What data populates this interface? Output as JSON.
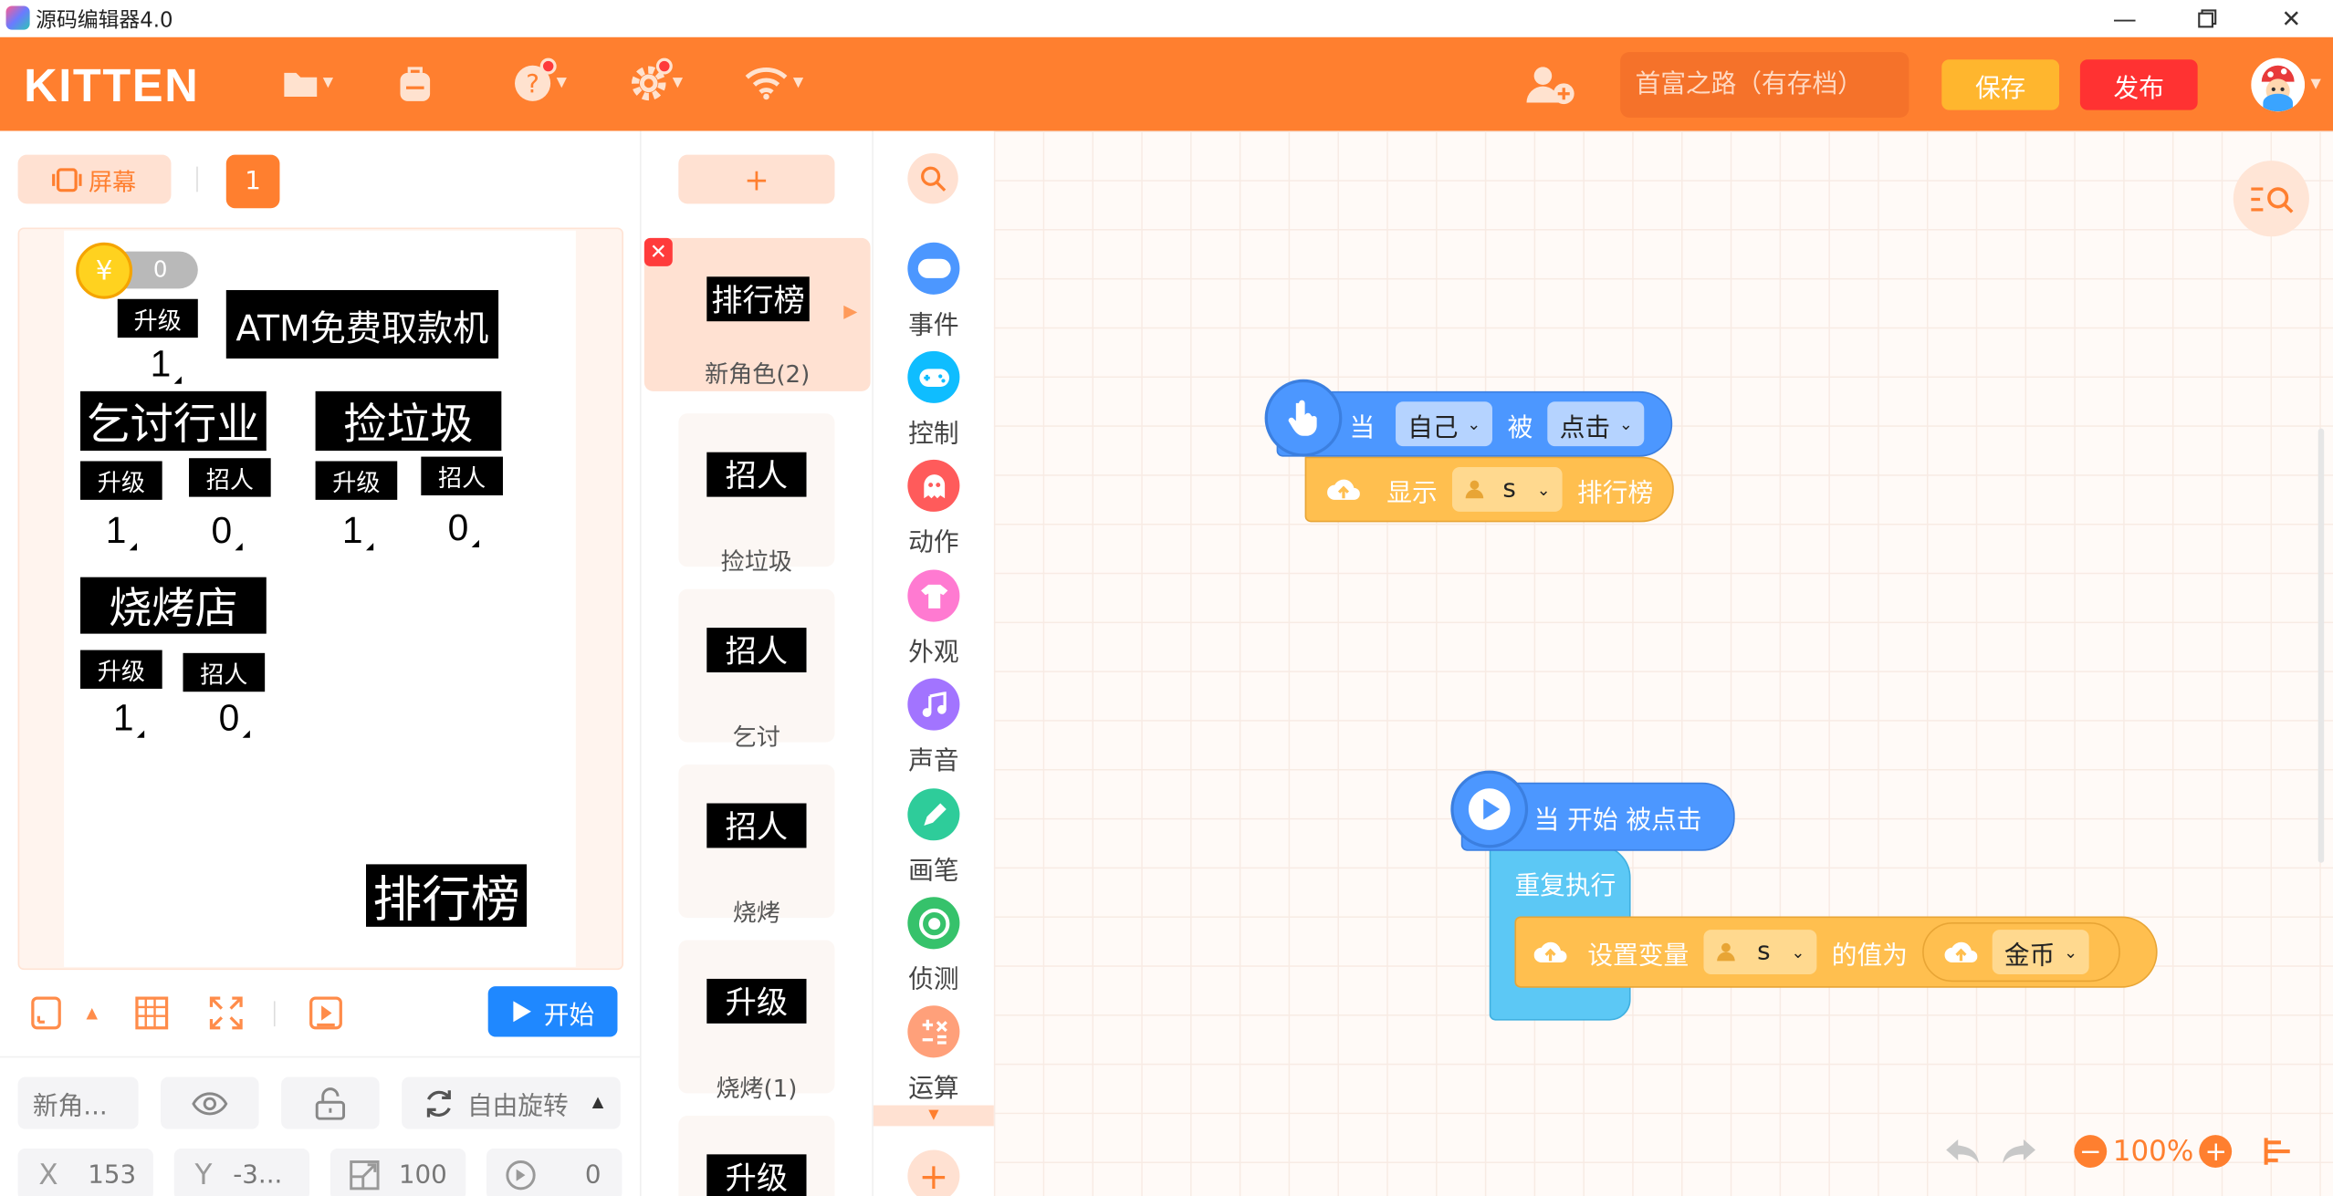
{
  "window": {
    "title": "源码编辑器4.0"
  },
  "header": {
    "logo": "KITTEN",
    "project_placeholder": "首富之路（有存档）",
    "save_label": "保存",
    "publish_label": "发布"
  },
  "left": {
    "screen_label": "屏幕",
    "scene_number": "1",
    "start_label": "开始",
    "sprite_name": "新角...",
    "rotate_label": "自由旋转",
    "x_label": "X",
    "x_value": "153",
    "y_label": "Y",
    "y_value": "-3...",
    "size_value": "100",
    "direction_value": "0"
  },
  "stage": {
    "coin_value": "0",
    "atm_title": "ATM免费取款机",
    "atm_upgrade": "升级",
    "atm_level": "1",
    "beg_title": "乞讨行业",
    "trash_title": "捡垃圾",
    "bbq_title": "烧烤店",
    "upgrade": "升级",
    "hire": "招人",
    "beg_level": "1",
    "beg_workers": "0",
    "trash_level": "1",
    "trash_workers": "0",
    "bbq_level": "1",
    "bbq_workers": "0",
    "rank_label": "排行榜"
  },
  "sprites": {
    "add_label": "+",
    "items": [
      {
        "thumb": "排行榜",
        "name": "新角色(2)"
      },
      {
        "thumb": "招人",
        "name": "捡垃圾"
      },
      {
        "thumb": "招人",
        "name": "乞讨"
      },
      {
        "thumb": "招人",
        "name": "烧烤"
      },
      {
        "thumb": "升级",
        "name": "烧烤(1)"
      },
      {
        "thumb": "升级",
        "name": ""
      }
    ]
  },
  "categories": [
    {
      "label": "事件",
      "color": "#4c97ff",
      "icon": "toggle-icon"
    },
    {
      "label": "控制",
      "color": "#0fbdff",
      "icon": "gamepad-icon"
    },
    {
      "label": "动作",
      "color": "#ff5b5b",
      "icon": "ghost-icon"
    },
    {
      "label": "外观",
      "color": "#ff7ad1",
      "icon": "shirt-icon"
    },
    {
      "label": "声音",
      "color": "#a274ff",
      "icon": "music-icon"
    },
    {
      "label": "画笔",
      "color": "#2ecc9a",
      "icon": "pen-icon"
    },
    {
      "label": "侦测",
      "color": "#36c26b",
      "icon": "target-icon"
    },
    {
      "label": "运算",
      "color": "#ffa07a",
      "icon": "math-icon"
    }
  ],
  "blocks": {
    "when": "当",
    "self": "自己",
    "by": "被",
    "clicked": "点击",
    "show": "显示",
    "var_s": "s",
    "rank": "排行榜",
    "when_start": "当 开始 被点击",
    "repeat": "重复执行",
    "set_var": "设置变量",
    "value_of": "的值为",
    "coin": "金币"
  },
  "workspace": {
    "zoom": "100%"
  },
  "colors": {
    "brand": "#ff7f2f",
    "event": "#4c97ff",
    "looks": "#ffbf4f",
    "control": "#5cc8f5",
    "publish": "#ff3232",
    "save": "#ffb62e",
    "start": "#1f88ff"
  }
}
